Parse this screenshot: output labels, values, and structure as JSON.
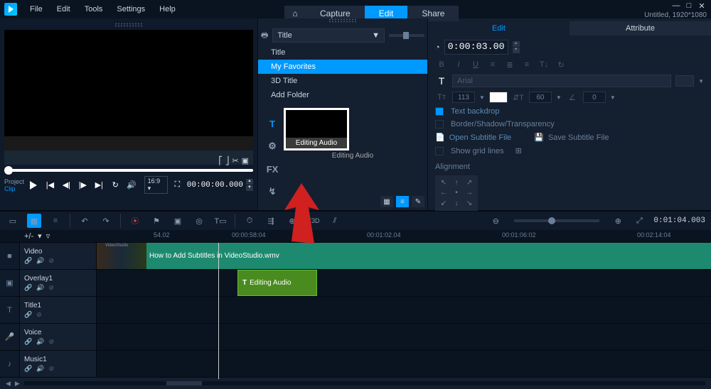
{
  "menu": {
    "file": "File",
    "edit": "Edit",
    "tools": "Tools",
    "settings": "Settings",
    "help": "Help"
  },
  "project_info": "Untitled, 1920*1080",
  "modes": {
    "capture": "Capture",
    "edit": "Edit",
    "share": "Share"
  },
  "preview": {
    "label_project": "Project",
    "label_clip": "Clip",
    "aspect": "16:9 ▾",
    "timecode": "00:00:00.000"
  },
  "library": {
    "dropdown": "Title",
    "items": [
      "Title",
      "My Favorites",
      "3D Title",
      "Add Folder"
    ],
    "thumb_label": "Editing Audio",
    "thumb_caption": "Editing Audio"
  },
  "options": {
    "tab_edit": "Edit",
    "tab_attribute": "Attribute",
    "duration": "0:00:03.000",
    "font": "Arial",
    "size1": "113",
    "size2": "60",
    "rotate": "0",
    "text_backdrop": "Text backdrop",
    "border_shadow": "Border/Shadow/Transparency",
    "open_subtitle": "Open Subtitle File",
    "save_subtitle": "Save Subtitle File",
    "show_gridlines": "Show grid lines",
    "alignment": "Alignment"
  },
  "timeline": {
    "current_tc": "0:01:04.003",
    "ruler": [
      "54.02",
      "00:00:58:04",
      "00:01:02.04",
      "00:01:06:02",
      "00:02:14:04"
    ],
    "tracks": {
      "video": "Video",
      "overlay": "Overlay1",
      "title": "Title1",
      "voice": "Voice",
      "music": "Music1"
    },
    "video_clip": "How to Add Subtitles in VideoStudio.wmv",
    "overlay_clip": "Editing Audio",
    "video_thumb_badge": "VideoStudio"
  }
}
